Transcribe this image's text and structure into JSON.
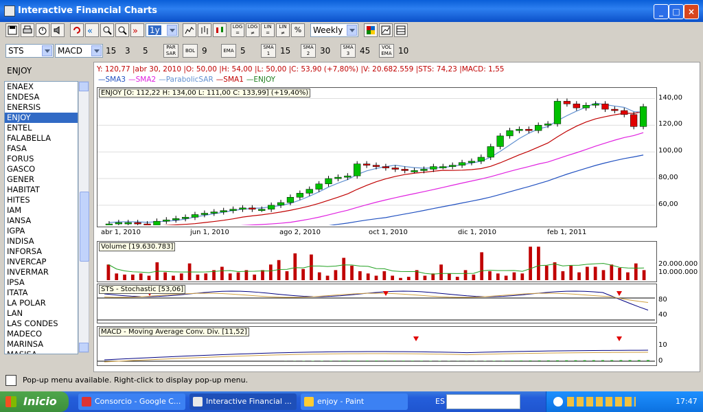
{
  "window": {
    "title": "Interactive Financial Charts"
  },
  "toolbar": {
    "period_select": "1y",
    "interval_select": "Weekly",
    "buttons": [
      "LOG =",
      "LOG ≠",
      "LIN =",
      "LIN ≠",
      "%"
    ]
  },
  "indicators_bar": {
    "symbol": "STS",
    "indicator": "MACD",
    "macd_params": [
      "15",
      "3",
      "5"
    ],
    "par_sar_label": "PAR SAR",
    "bol_label": "BOL",
    "bol_value": "9",
    "ema_label": "EMA",
    "ema_value": "5",
    "sma1_label": "SMA 1",
    "sma1_value": "15",
    "sma2_label": "SMA 2",
    "sma2_value": "30",
    "sma3_label": "SMA 3",
    "sma3_value": "45",
    "vol_ema_label": "VOL EMA",
    "vol_ema_value": "10"
  },
  "sidebar": {
    "selected_symbol": "ENJOY",
    "items": [
      "ENAEX",
      "ENDESA",
      "ENERSIS",
      "ENJOY",
      "ENTEL",
      "FALABELLA",
      "FASA",
      "FORUS",
      "GASCO",
      "GENER",
      "HABITAT",
      "HITES",
      "IAM",
      "IANSA",
      "IGPA",
      "INDISA",
      "INFORSA",
      "INVERCAP",
      "INVERMAR",
      "IPSA",
      "ITATA",
      "LA POLAR",
      "LAN",
      "LAS CONDES",
      "MADECO",
      "MARINSA",
      "MASISA"
    ]
  },
  "chart": {
    "info_line": "Y: 120,77 |abr 30, 2010 |O: 50,00 |H: 54,00 |L: 50,00 |C: 53,90 (+7,80%) |V: 20.682.559 |STS: 74,23 |MACD: 1,55",
    "legend": [
      {
        "label": "SMA3",
        "color": "#2050c0"
      },
      {
        "label": "SMA2",
        "color": "#e020e0"
      },
      {
        "label": "ParabolicSAR",
        "color": "#6090d0"
      },
      {
        "label": "SMA1",
        "color": "#c00000"
      },
      {
        "label": "ENJOY",
        "color": "#208020"
      }
    ],
    "ohlc_label": "ENJOY [O: 112,22  H: 134,00  L: 111,00  C: 133,99] (+19,40%)",
    "volume_label": "Volume [19.630.783]",
    "sts_label": "STS - Stochastic [53,06]",
    "macd_label": "MACD - Moving Average Conv. Div. [11,52]",
    "x_tick_labels": [
      "abr 1, 2010",
      "jun 1, 2010",
      "ago 2, 2010",
      "oct 1, 2010",
      "dic 1, 2010",
      "feb 1, 2011"
    ],
    "price_axis": [
      "140,00",
      "120,00",
      "100,00",
      "80,00",
      "60,00"
    ],
    "volume_axis": [
      "20.000.000",
      "10.000.000"
    ],
    "sts_axis": [
      "80",
      "40"
    ],
    "macd_axis": [
      "10",
      "0"
    ]
  },
  "chart_data": {
    "type": "candlestick",
    "title": "ENJOY",
    "x_ticks": [
      "abr 1, 2010",
      "jun 1, 2010",
      "ago 2, 2010",
      "oct 1, 2010",
      "dic 1, 2010",
      "feb 1, 2011"
    ],
    "ylim": [
      45,
      148
    ],
    "close": [
      46,
      47,
      47,
      46,
      45,
      48,
      49,
      50,
      51,
      53,
      54,
      55,
      56,
      57,
      58,
      57,
      57,
      60,
      62,
      66,
      69,
      72,
      76,
      80,
      81,
      82,
      91,
      90,
      89,
      88,
      87,
      86,
      86,
      87,
      89,
      89,
      90,
      92,
      93,
      96,
      104,
      112,
      116,
      117,
      116,
      120,
      121,
      138,
      136,
      133,
      135,
      136,
      132,
      131,
      128,
      119,
      134
    ],
    "volume_millions": [
      14,
      6,
      5,
      5,
      6,
      4,
      16,
      7,
      4,
      6,
      15,
      5,
      6,
      9,
      12,
      6,
      7,
      9,
      5,
      9,
      14,
      18,
      8,
      24,
      10,
      23,
      7,
      4,
      9,
      20,
      13,
      8,
      6,
      4,
      8,
      4,
      2,
      3,
      9,
      4,
      6,
      14,
      6,
      3,
      9,
      5,
      25,
      8,
      6,
      4,
      7,
      6,
      30,
      30,
      13,
      16,
      8,
      13,
      7,
      12,
      12,
      9,
      14,
      11,
      7,
      15,
      9
    ]
  },
  "status": {
    "message": "Pop-up menu available. Right-click to display pop-up menu."
  },
  "taskbar": {
    "start_label": "Inicio",
    "tasks": [
      "Consorcio - Google C...",
      "Interactive Financial ...",
      "enjoy - Paint"
    ],
    "lang": "ES",
    "time": "17:47"
  }
}
